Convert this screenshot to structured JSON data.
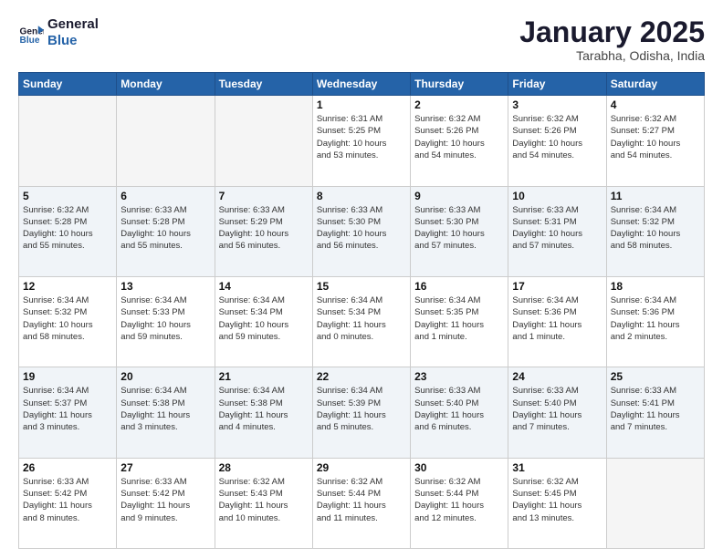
{
  "logo": {
    "line1": "General",
    "line2": "Blue"
  },
  "header": {
    "month": "January 2025",
    "location": "Tarabha, Odisha, India"
  },
  "weekdays": [
    "Sunday",
    "Monday",
    "Tuesday",
    "Wednesday",
    "Thursday",
    "Friday",
    "Saturday"
  ],
  "weeks": [
    [
      {
        "day": "",
        "info": ""
      },
      {
        "day": "",
        "info": ""
      },
      {
        "day": "",
        "info": ""
      },
      {
        "day": "1",
        "info": "Sunrise: 6:31 AM\nSunset: 5:25 PM\nDaylight: 10 hours\nand 53 minutes."
      },
      {
        "day": "2",
        "info": "Sunrise: 6:32 AM\nSunset: 5:26 PM\nDaylight: 10 hours\nand 54 minutes."
      },
      {
        "day": "3",
        "info": "Sunrise: 6:32 AM\nSunset: 5:26 PM\nDaylight: 10 hours\nand 54 minutes."
      },
      {
        "day": "4",
        "info": "Sunrise: 6:32 AM\nSunset: 5:27 PM\nDaylight: 10 hours\nand 54 minutes."
      }
    ],
    [
      {
        "day": "5",
        "info": "Sunrise: 6:32 AM\nSunset: 5:28 PM\nDaylight: 10 hours\nand 55 minutes."
      },
      {
        "day": "6",
        "info": "Sunrise: 6:33 AM\nSunset: 5:28 PM\nDaylight: 10 hours\nand 55 minutes."
      },
      {
        "day": "7",
        "info": "Sunrise: 6:33 AM\nSunset: 5:29 PM\nDaylight: 10 hours\nand 56 minutes."
      },
      {
        "day": "8",
        "info": "Sunrise: 6:33 AM\nSunset: 5:30 PM\nDaylight: 10 hours\nand 56 minutes."
      },
      {
        "day": "9",
        "info": "Sunrise: 6:33 AM\nSunset: 5:30 PM\nDaylight: 10 hours\nand 57 minutes."
      },
      {
        "day": "10",
        "info": "Sunrise: 6:33 AM\nSunset: 5:31 PM\nDaylight: 10 hours\nand 57 minutes."
      },
      {
        "day": "11",
        "info": "Sunrise: 6:34 AM\nSunset: 5:32 PM\nDaylight: 10 hours\nand 58 minutes."
      }
    ],
    [
      {
        "day": "12",
        "info": "Sunrise: 6:34 AM\nSunset: 5:32 PM\nDaylight: 10 hours\nand 58 minutes."
      },
      {
        "day": "13",
        "info": "Sunrise: 6:34 AM\nSunset: 5:33 PM\nDaylight: 10 hours\nand 59 minutes."
      },
      {
        "day": "14",
        "info": "Sunrise: 6:34 AM\nSunset: 5:34 PM\nDaylight: 10 hours\nand 59 minutes."
      },
      {
        "day": "15",
        "info": "Sunrise: 6:34 AM\nSunset: 5:34 PM\nDaylight: 11 hours\nand 0 minutes."
      },
      {
        "day": "16",
        "info": "Sunrise: 6:34 AM\nSunset: 5:35 PM\nDaylight: 11 hours\nand 1 minute."
      },
      {
        "day": "17",
        "info": "Sunrise: 6:34 AM\nSunset: 5:36 PM\nDaylight: 11 hours\nand 1 minute."
      },
      {
        "day": "18",
        "info": "Sunrise: 6:34 AM\nSunset: 5:36 PM\nDaylight: 11 hours\nand 2 minutes."
      }
    ],
    [
      {
        "day": "19",
        "info": "Sunrise: 6:34 AM\nSunset: 5:37 PM\nDaylight: 11 hours\nand 3 minutes."
      },
      {
        "day": "20",
        "info": "Sunrise: 6:34 AM\nSunset: 5:38 PM\nDaylight: 11 hours\nand 3 minutes."
      },
      {
        "day": "21",
        "info": "Sunrise: 6:34 AM\nSunset: 5:38 PM\nDaylight: 11 hours\nand 4 minutes."
      },
      {
        "day": "22",
        "info": "Sunrise: 6:34 AM\nSunset: 5:39 PM\nDaylight: 11 hours\nand 5 minutes."
      },
      {
        "day": "23",
        "info": "Sunrise: 6:33 AM\nSunset: 5:40 PM\nDaylight: 11 hours\nand 6 minutes."
      },
      {
        "day": "24",
        "info": "Sunrise: 6:33 AM\nSunset: 5:40 PM\nDaylight: 11 hours\nand 7 minutes."
      },
      {
        "day": "25",
        "info": "Sunrise: 6:33 AM\nSunset: 5:41 PM\nDaylight: 11 hours\nand 7 minutes."
      }
    ],
    [
      {
        "day": "26",
        "info": "Sunrise: 6:33 AM\nSunset: 5:42 PM\nDaylight: 11 hours\nand 8 minutes."
      },
      {
        "day": "27",
        "info": "Sunrise: 6:33 AM\nSunset: 5:42 PM\nDaylight: 11 hours\nand 9 minutes."
      },
      {
        "day": "28",
        "info": "Sunrise: 6:32 AM\nSunset: 5:43 PM\nDaylight: 11 hours\nand 10 minutes."
      },
      {
        "day": "29",
        "info": "Sunrise: 6:32 AM\nSunset: 5:44 PM\nDaylight: 11 hours\nand 11 minutes."
      },
      {
        "day": "30",
        "info": "Sunrise: 6:32 AM\nSunset: 5:44 PM\nDaylight: 11 hours\nand 12 minutes."
      },
      {
        "day": "31",
        "info": "Sunrise: 6:32 AM\nSunset: 5:45 PM\nDaylight: 11 hours\nand 13 minutes."
      },
      {
        "day": "",
        "info": ""
      }
    ]
  ]
}
